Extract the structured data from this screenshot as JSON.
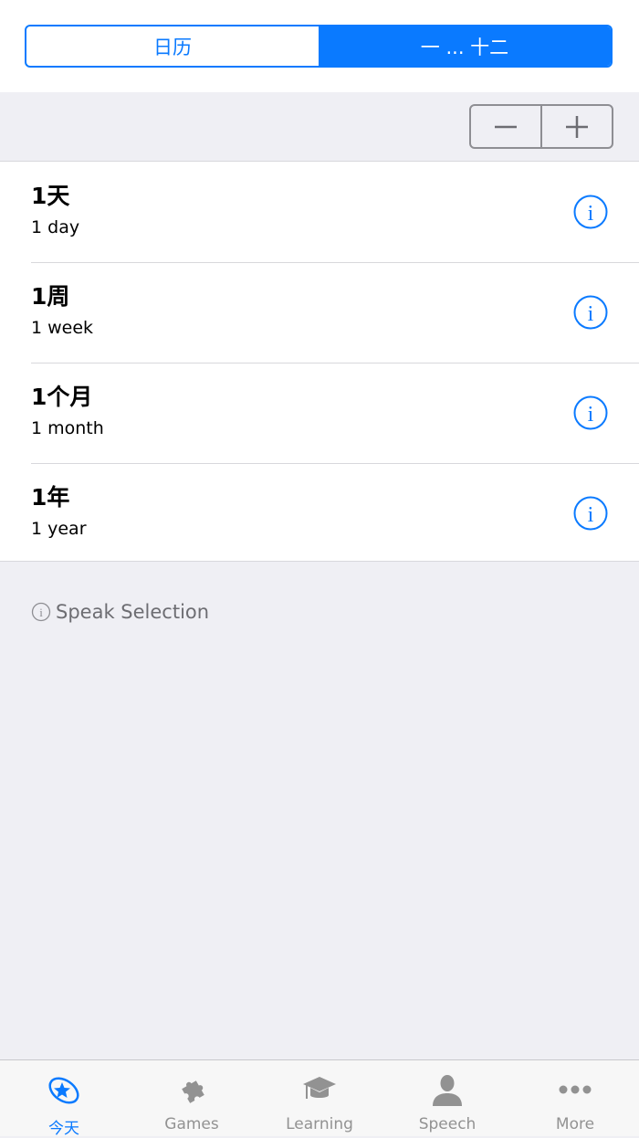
{
  "segmented_control": {
    "options": [
      "日历",
      "一 ... 十二"
    ],
    "selected_index": 1
  },
  "stepper": {
    "minus_label": "−",
    "plus_label": "+"
  },
  "list": {
    "items": [
      {
        "title": "1天",
        "subtitle": "1 day"
      },
      {
        "title": "1周",
        "subtitle": "1 week"
      },
      {
        "title": "1个月",
        "subtitle": "1 month"
      },
      {
        "title": "1年",
        "subtitle": "1 year"
      }
    ]
  },
  "footer_note": "Speak Selection",
  "tabbar": {
    "tabs": [
      {
        "label": "今天",
        "icon": "star-icon",
        "active": true
      },
      {
        "label": "Games",
        "icon": "puzzle-icon",
        "active": false
      },
      {
        "label": "Learning",
        "icon": "graduation-cap-icon",
        "active": false
      },
      {
        "label": "Speech",
        "icon": "person-icon",
        "active": false
      },
      {
        "label": "More",
        "icon": "more-icon",
        "active": false
      }
    ]
  },
  "colors": {
    "accent": "#0a7aff",
    "background": "#efeff4",
    "inactive": "#929292"
  }
}
